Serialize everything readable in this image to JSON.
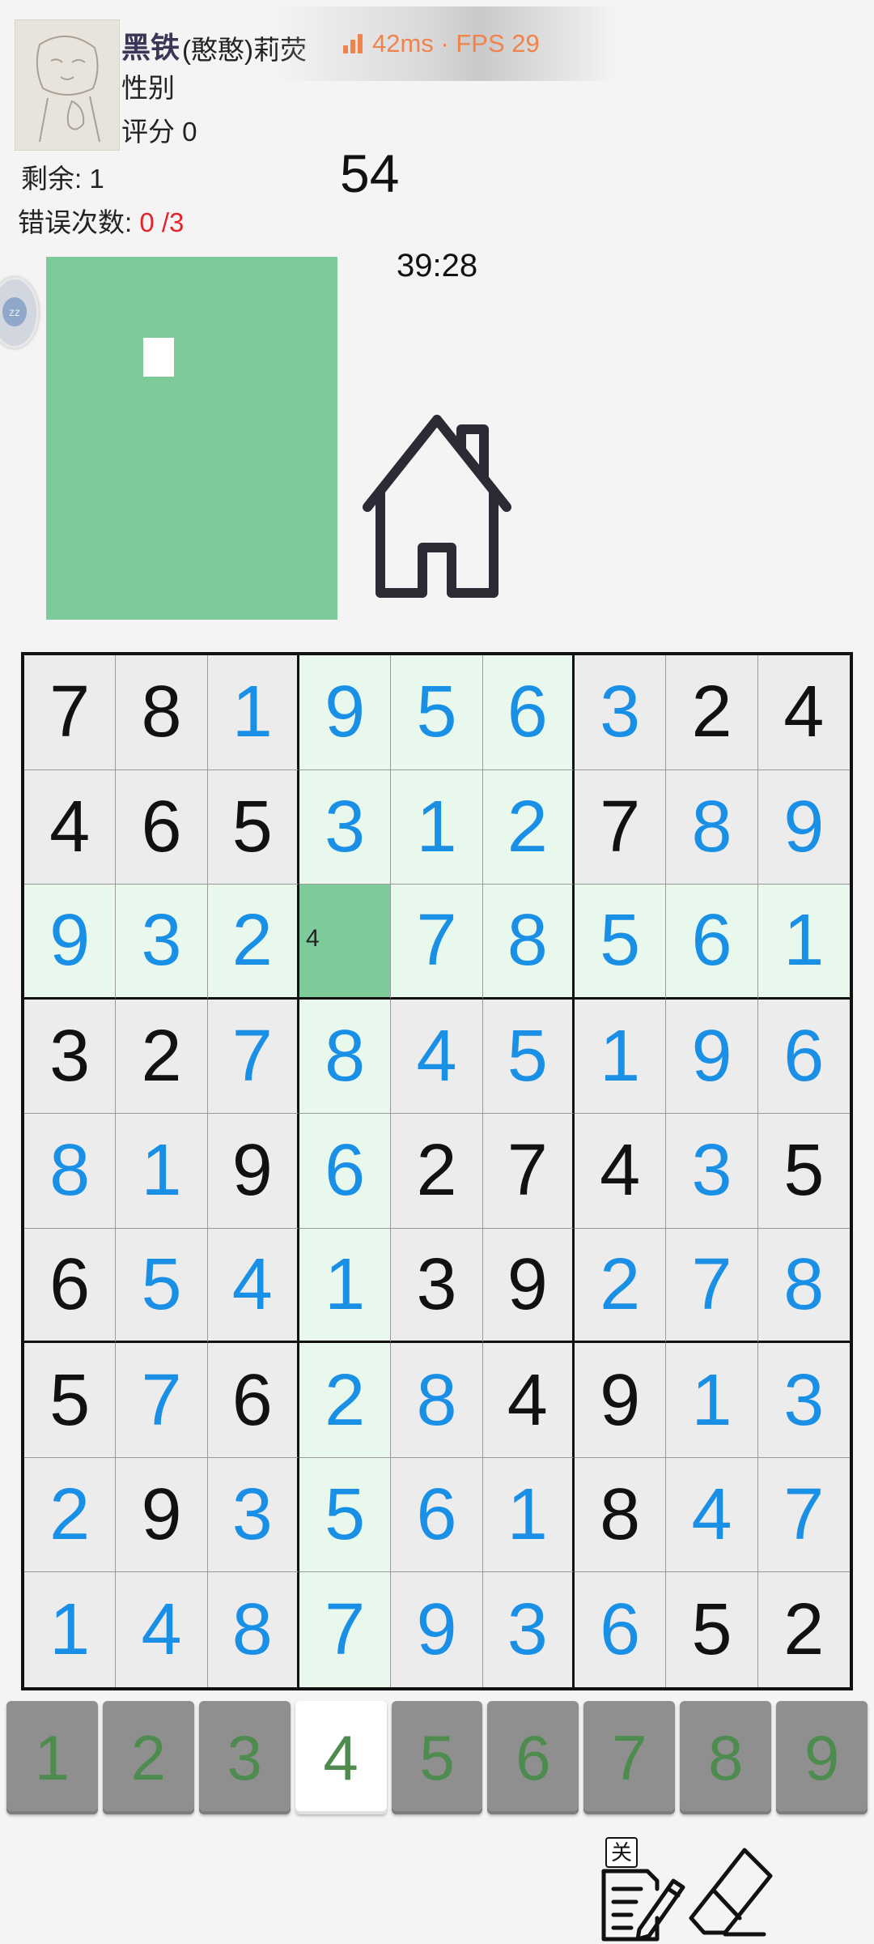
{
  "player": {
    "rank": "黑铁",
    "nickname": "(憨憨)莉荧",
    "gender_label": "性别",
    "score_text": "评分  0"
  },
  "network": {
    "status_text": "42ms · FPS 29",
    "color": "#f0824c"
  },
  "game": {
    "remaining_text": "剩余: 1",
    "errors_label": "错误次数: ",
    "errors_value": "0 /3",
    "progress_number": "54",
    "timer": "39:28"
  },
  "side_handle": {
    "label": "zz"
  },
  "board": {
    "selected": {
      "row": 2,
      "col": 3
    },
    "selected_note": "4",
    "highlight_rows": [
      2
    ],
    "highlight_cols": [
      3
    ],
    "highlight_box": [
      0,
      1
    ],
    "cells": [
      [
        "7",
        "8",
        "1",
        "9",
        "5",
        "6",
        "3",
        "2",
        "4"
      ],
      [
        "4",
        "6",
        "5",
        "3",
        "1",
        "2",
        "7",
        "8",
        "9"
      ],
      [
        "9",
        "3",
        "2",
        "",
        "7",
        "8",
        "5",
        "6",
        "1"
      ],
      [
        "3",
        "2",
        "7",
        "8",
        "4",
        "5",
        "1",
        "9",
        "6"
      ],
      [
        "8",
        "1",
        "9",
        "6",
        "2",
        "7",
        "4",
        "3",
        "5"
      ],
      [
        "6",
        "5",
        "4",
        "1",
        "3",
        "9",
        "2",
        "7",
        "8"
      ],
      [
        "5",
        "7",
        "6",
        "2",
        "8",
        "4",
        "9",
        "1",
        "3"
      ],
      [
        "2",
        "9",
        "3",
        "5",
        "6",
        "1",
        "8",
        "4",
        "7"
      ],
      [
        "1",
        "4",
        "8",
        "7",
        "9",
        "3",
        "6",
        "5",
        "2"
      ]
    ],
    "givens": [
      [
        1,
        1,
        0,
        0,
        0,
        0,
        0,
        1,
        1
      ],
      [
        1,
        1,
        1,
        0,
        0,
        0,
        1,
        0,
        0
      ],
      [
        0,
        0,
        0,
        0,
        0,
        0,
        0,
        0,
        0
      ],
      [
        1,
        1,
        0,
        0,
        0,
        0,
        0,
        0,
        0
      ],
      [
        0,
        0,
        1,
        0,
        1,
        1,
        1,
        0,
        1
      ],
      [
        1,
        0,
        0,
        0,
        1,
        1,
        0,
        0,
        0
      ],
      [
        1,
        0,
        1,
        0,
        0,
        1,
        1,
        0,
        0
      ],
      [
        0,
        1,
        0,
        0,
        0,
        0,
        1,
        0,
        0
      ],
      [
        0,
        0,
        0,
        0,
        0,
        0,
        0,
        1,
        1
      ]
    ],
    "given_color": "#111111",
    "filled_color": "#1a8fe6",
    "highlight_color": "#e8f8ec",
    "selected_color": "#7dcb9b"
  },
  "numpad": {
    "keys": [
      "1",
      "2",
      "3",
      "4",
      "5",
      "6",
      "7",
      "8",
      "9"
    ],
    "active_key": "4",
    "digit_color": "#4e8b4e"
  },
  "tools": {
    "notes_toggle_label": "关",
    "notes_icon": "notes-pencil-icon",
    "eraser_icon": "eraser-icon",
    "home_icon": "home-icon"
  }
}
